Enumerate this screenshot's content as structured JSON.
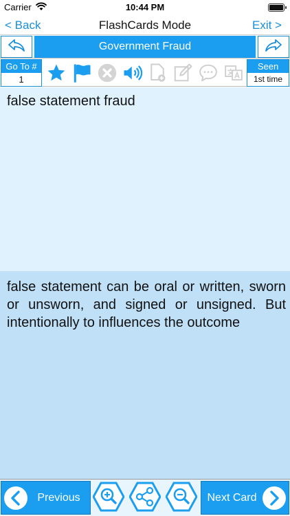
{
  "status": {
    "carrier": "Carrier",
    "time": "10:44 PM"
  },
  "nav": {
    "back_label": "< Back",
    "title": "FlashCards Mode",
    "exit_label": "Exit >"
  },
  "category": {
    "title": "Government Fraud"
  },
  "toolbar": {
    "goto_label": "Go To #",
    "goto_value": "1",
    "seen_label": "Seen",
    "seen_value": "1st time",
    "icons": [
      "star-icon",
      "flag-icon",
      "remove-icon",
      "speaker-icon",
      "add-note-icon",
      "edit-icon",
      "comment-icon",
      "translate-icon"
    ]
  },
  "card": {
    "term": "false statement fraud",
    "definition": "false statement can be oral or written, sworn or unsworn, and signed or unsigned. But intentionally to influences the outcome"
  },
  "bottom": {
    "previous_label": "Previous",
    "next_label": "Next Card"
  },
  "colors": {
    "accent": "#1b9ef0",
    "link": "#1a8fd8",
    "term_bg": "#dff2fd",
    "definition_bg": "#bfe0f7",
    "disabled": "#cfcfcf"
  }
}
